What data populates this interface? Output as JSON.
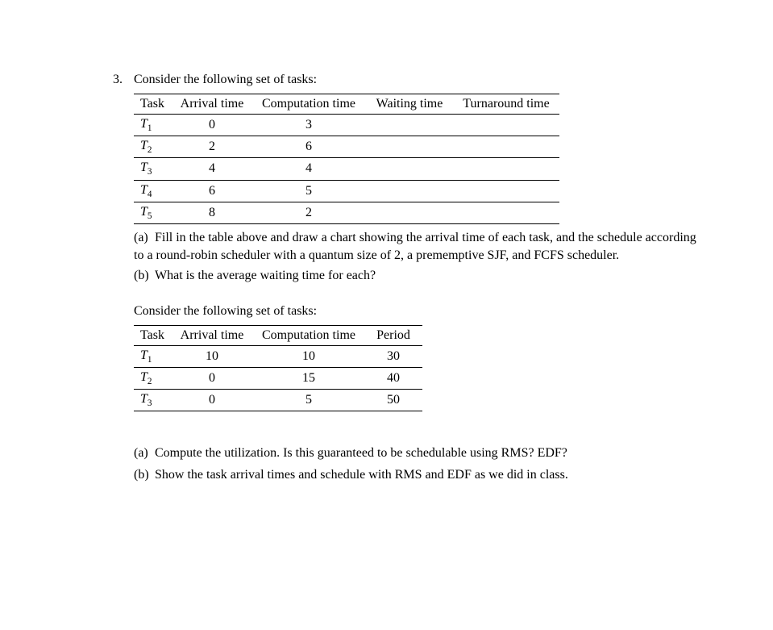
{
  "problem_number": "3.",
  "lead1": "Consider the following set of tasks:",
  "table1": {
    "headers": [
      "Task",
      "Arrival time",
      "Computation time",
      "Waiting time",
      "Turnaround time"
    ],
    "rows": [
      {
        "task": "T",
        "sub": "1",
        "arr": "0",
        "comp": "3",
        "wait": "",
        "turn": ""
      },
      {
        "task": "T",
        "sub": "2",
        "arr": "2",
        "comp": "6",
        "wait": "",
        "turn": ""
      },
      {
        "task": "T",
        "sub": "3",
        "arr": "4",
        "comp": "4",
        "wait": "",
        "turn": ""
      },
      {
        "task": "T",
        "sub": "4",
        "arr": "6",
        "comp": "5",
        "wait": "",
        "turn": ""
      },
      {
        "task": "T",
        "sub": "5",
        "arr": "8",
        "comp": "2",
        "wait": "",
        "turn": ""
      }
    ]
  },
  "subparts1": [
    {
      "label": "(a)",
      "text": "Fill in the table above and draw a chart showing the arrival time of each task, and the schedule according to a round-robin scheduler with a quantum size of 2, a prememptive SJF, and FCFS scheduler."
    },
    {
      "label": "(b)",
      "text": "What is the average waiting time for each?"
    }
  ],
  "lead2": "Consider the following set of tasks:",
  "table2": {
    "headers": [
      "Task",
      "Arrival time",
      "Computation time",
      "Period"
    ],
    "rows": [
      {
        "task": "T",
        "sub": "1",
        "arr": "10",
        "comp": "10",
        "per": "30"
      },
      {
        "task": "T",
        "sub": "2",
        "arr": "0",
        "comp": "15",
        "per": "40"
      },
      {
        "task": "T",
        "sub": "3",
        "arr": "0",
        "comp": "5",
        "per": "50"
      }
    ]
  },
  "subparts2": [
    {
      "label": "(a)",
      "text": "Compute  the  utilization.    Is  this  guaranteed  to  be  schedulable  using  RMS?  EDF?"
    },
    {
      "label": "(b)",
      "text": "Show the task arrival times and schedule with RMS and EDF as we did in class."
    }
  ]
}
